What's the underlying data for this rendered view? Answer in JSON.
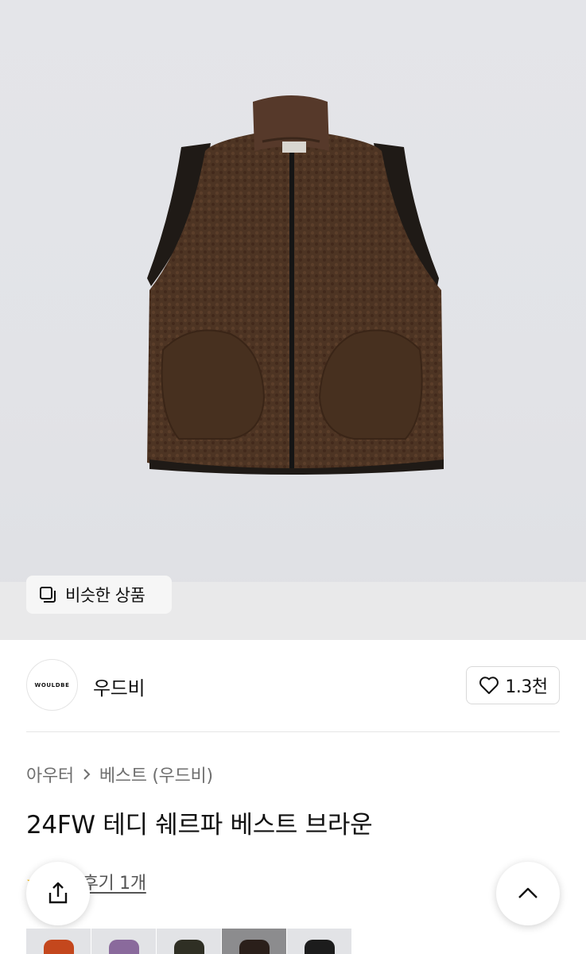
{
  "similar_button": {
    "label": "비슷한 상품"
  },
  "brand": {
    "logo_text": "WOULDBE",
    "name": "우드비"
  },
  "like": {
    "count": "1.3천"
  },
  "breadcrumb": {
    "level1": "아우터",
    "level2": "베스트 (우드비)"
  },
  "product": {
    "title": "24FW 테디 쉐르파 베스트 브라운"
  },
  "review": {
    "link_text": "후기 1개"
  },
  "icons": {
    "similar": "similar-products-icon",
    "heart": "heart-outline-icon",
    "share": "share-icon",
    "scroll_top": "chevron-up-icon"
  },
  "thumbnails": [
    {
      "color": "#c4471d"
    },
    {
      "color": "#8a6a9c"
    },
    {
      "color": "#2f2f24"
    },
    {
      "color": "#2a1f1a"
    },
    {
      "color": "#1c1c1c"
    }
  ],
  "colors": {
    "vest": "#4d3423",
    "background": "#e3e4e8",
    "accent_star": "#f4b400"
  }
}
